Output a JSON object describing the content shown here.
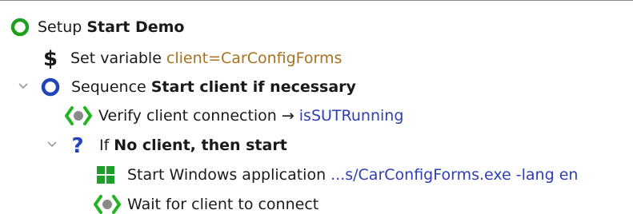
{
  "tree": {
    "rows": [
      {
        "prefix": "Setup",
        "bold": "Start Demo"
      },
      {
        "prefix": "Set variable",
        "value": "client=CarConfigForms"
      },
      {
        "prefix": "Sequence",
        "bold": "Start client if necessary"
      },
      {
        "prefix": "Verify client connection",
        "arrow": "→",
        "value": "isSUTRunning"
      },
      {
        "prefix": "If",
        "bold": "No client, then start"
      },
      {
        "prefix": "Start Windows application",
        "value": "...s/CarConfigForms.exe -lang en"
      },
      {
        "prefix": "Wait for client to connect"
      }
    ]
  },
  "icons": {
    "setup": "setup-circle-icon",
    "variable": "dollar-icon",
    "sequence": "sequence-circle-icon",
    "verify": "verify-connection-icon",
    "if": "question-mark-icon",
    "windows": "windows-app-icon",
    "wait": "wait-connection-icon"
  },
  "colors": {
    "setup_green": "#1fa01f",
    "sequence_blue": "#2244bb",
    "value_orange": "#a8721f",
    "link_blue": "#2d3fb3",
    "verify_green": "#22b422",
    "windows_green": "#1e9e2a"
  }
}
